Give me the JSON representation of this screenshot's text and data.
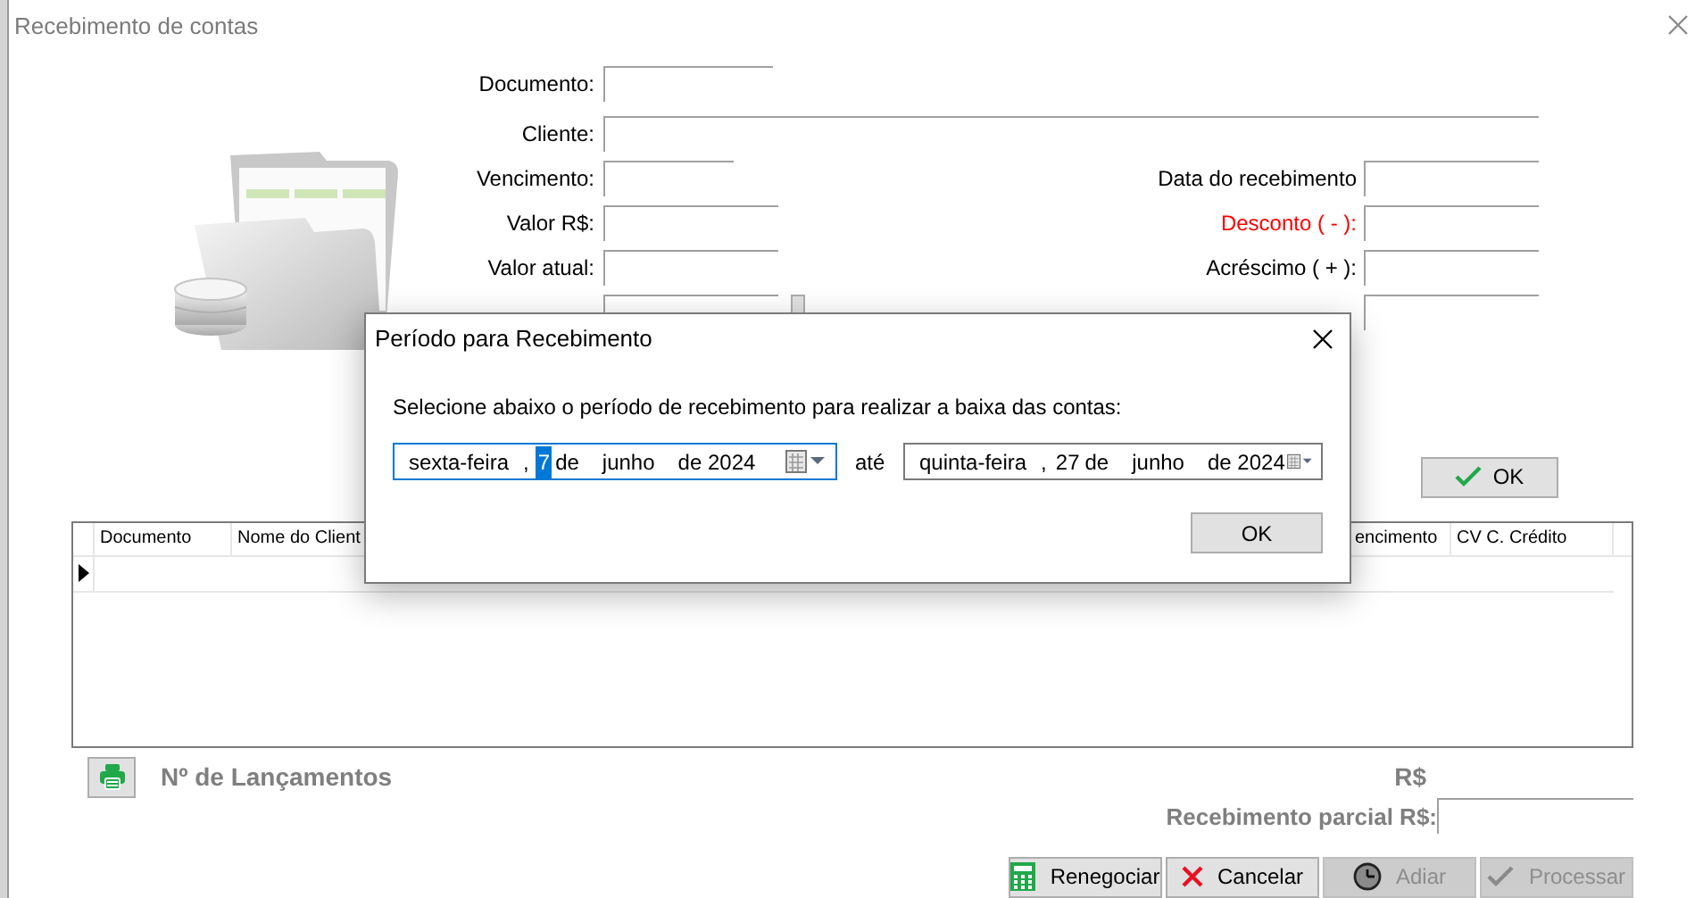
{
  "window": {
    "title": "Recebimento de contas"
  },
  "rows": [
    {
      "left": {
        "label": "Documento:",
        "kind": "short"
      }
    },
    {
      "left": {
        "label": "Cliente:",
        "kind": "full"
      }
    },
    {
      "left": {
        "label": "Vencimento:",
        "kind": "date"
      },
      "right": {
        "label": "Data do recebimento",
        "kind": "labelled"
      }
    },
    {
      "left": {
        "label": "Valor R$:",
        "kind": "medium"
      },
      "right": {
        "label": "Desconto ( - ):",
        "kind": "labelled",
        "emphasis": true
      }
    },
    {
      "left": {
        "label": "Valor atual:",
        "kind": "medium"
      },
      "right": {
        "label": "Acréscimo ( + ):",
        "kind": "labelled"
      }
    },
    {
      "left": {
        "kind": "spin"
      },
      "right": {
        "kind": "plain"
      }
    }
  ],
  "ok_button": "OK",
  "table": {
    "columns": [
      {
        "label": "Documento",
        "kind": "fixed"
      },
      {
        "label": "Nome do Client",
        "kind": "fill"
      },
      {
        "label": "encimento",
        "kind": "narrow"
      },
      {
        "label": "CV C. Crédito",
        "kind": "wide"
      }
    ],
    "rows": [
      {
        "current": true
      }
    ]
  },
  "footer": {
    "count_label": "Nº de Lançamentos",
    "total_label": "R$",
    "partial_label": "Recebimento parcial R$:"
  },
  "buttons": [
    {
      "label": "Renegociar",
      "disabled": false
    },
    {
      "label": "Cancelar",
      "disabled": false
    },
    {
      "label": "Adiar",
      "disabled": true
    },
    {
      "label": "Processar",
      "disabled": true
    }
  ],
  "dialog": {
    "title": "Período para Recebimento",
    "message": "Selecione abaixo o período de recebimento para realizar a baixa das contas:",
    "from": {
      "focused": true,
      "parts": [
        {
          "text": "sexta-feira",
          "selected": false
        },
        {
          "text": ",",
          "selected": false
        },
        {
          "text": "7",
          "selected": true
        },
        {
          "text": "de",
          "selected": false
        },
        {
          "text": "junho",
          "selected": false
        },
        {
          "text": "de 2024",
          "selected": false
        }
      ]
    },
    "separator": "até",
    "to": {
      "focused": false,
      "parts": [
        {
          "text": "quinta-feira",
          "selected": false
        },
        {
          "text": ",",
          "selected": false
        },
        {
          "text": "27",
          "selected": false
        },
        {
          "text": "de",
          "selected": false
        },
        {
          "text": "junho",
          "selected": false
        },
        {
          "text": "de 2024",
          "selected": false
        }
      ]
    },
    "ok": "OK"
  }
}
